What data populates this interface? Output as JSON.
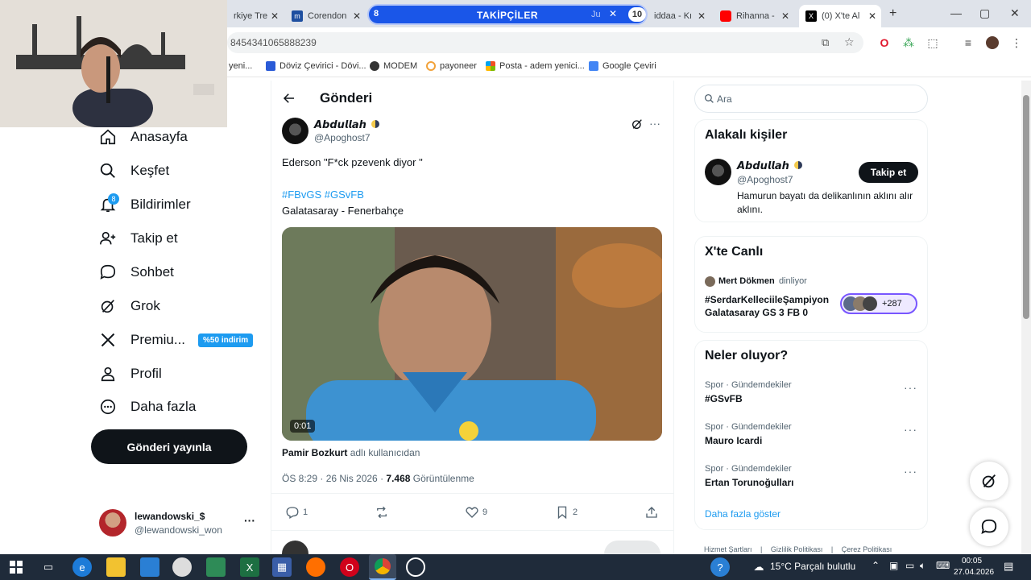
{
  "browser": {
    "tabs": [
      {
        "label": "rkiye Tre",
        "favicon": "generic-icon"
      },
      {
        "label": "Corendon",
        "favicon": "corendon-icon",
        "color": "#1e4fa0"
      },
      {
        "label": "Ju",
        "favicon": "generic-icon"
      },
      {
        "label": "iddaa - Kı",
        "favicon": "iddaa-icon"
      },
      {
        "label": "Rihanna -",
        "favicon": "youtube-icon",
        "color": "#ff0000"
      },
      {
        "label": "(0) X'te Al",
        "favicon": "x-icon",
        "active": true
      }
    ],
    "tab_group": {
      "title": "TAKİPÇİLER",
      "left_count": "8",
      "right_count": "10",
      "color": "#1a56e8"
    },
    "new_tab": "+",
    "window_controls": [
      "—",
      "▢",
      "✕"
    ],
    "url": "8454341065888239",
    "bookmarks": [
      {
        "label": "yeni...",
        "icon": "doc-icon"
      },
      {
        "label": "Döviz Çevirici - Dövi...",
        "icon": "exchange-icon"
      },
      {
        "label": "MODEM",
        "icon": "globe-icon"
      },
      {
        "label": "payoneer",
        "icon": "payoneer-icon"
      },
      {
        "label": "Posta - adem yenici...",
        "icon": "microsoft-icon"
      },
      {
        "label": "Google Çeviri",
        "icon": "translate-icon"
      }
    ]
  },
  "left_nav": {
    "items": [
      {
        "label": "Anasayfa",
        "icon": "home-icon"
      },
      {
        "label": "Keşfet",
        "icon": "search-icon"
      },
      {
        "label": "Bildirimler",
        "icon": "bell-icon",
        "badge": "8"
      },
      {
        "label": "Takip et",
        "icon": "person-add-icon"
      },
      {
        "label": "Sohbet",
        "icon": "chat-icon"
      },
      {
        "label": "Grok",
        "icon": "grok-icon"
      },
      {
        "label": "Premiu...",
        "icon": "x-logo-icon",
        "promo": "%50 indirim"
      },
      {
        "label": "Profil",
        "icon": "person-icon"
      },
      {
        "label": "Daha fazla",
        "icon": "more-circle-icon"
      }
    ],
    "post_button": "Gönderi yayınla",
    "account": {
      "name": "lewandowski_$",
      "handle": "@lewandowski_won",
      "more": "···"
    }
  },
  "post": {
    "header_title": "Gönderi",
    "author_name": "𝘼𝙗𝙙𝙪𝙡𝙡𝙖𝙝",
    "author_handle": "@Apoghost7",
    "text": "Ederson \"F*ck pzevenk diyor \"",
    "hashtags": "#FBvGS #GSvFB",
    "line2": "Galatasaray - Fenerbahçe",
    "video_time": "0:01",
    "attribution_user": "Pamir Bozkurt",
    "attribution_suffix": "adlı kullanıcıdan",
    "time": "ÖS 8:29 · 26 Nis 2026 · ",
    "views": "7.468",
    "views_label": "Görüntülenme",
    "replies": "1",
    "likes": "9",
    "bookmarks": "2"
  },
  "right": {
    "search_placeholder": "Ara",
    "related_title": "Alakalı kişiler",
    "related": {
      "name": "𝘼𝙗𝙙𝙪𝙡𝙡𝙖𝙝",
      "handle": "@Apoghost7",
      "bio": "Hamurun bayatı da delikanlının aklını alır aklını.",
      "follow": "Takip et"
    },
    "live_title": "X'te Canlı",
    "live": {
      "host": "Mert Dökmen",
      "status": "dinliyor",
      "title": "#SerdarKelleciileŞampiyonGalatasaray GS 3 FB 0",
      "count": "+287"
    },
    "trends_title": "Neler oluyor?",
    "trends": [
      {
        "context": "Spor · Gündemdekiler",
        "name": "#GSvFB"
      },
      {
        "context": "Spor · Gündemdekiler",
        "name": "Mauro Icardi"
      },
      {
        "context": "Spor · Gündemdekiler",
        "name": "Ertan Torunoğulları"
      }
    ],
    "show_more": "Daha fazla göster",
    "footer": [
      "Hizmet Şartları",
      "Gizlilik Politikası",
      "Çerez Politikası"
    ]
  },
  "taskbar": {
    "weather": "15°C  Parçalı bulutlu",
    "time": "00:05",
    "date": "27.04.2026"
  },
  "colors": {
    "accent": "#1d9bf0",
    "dark": "#0f1419",
    "muted": "#536471"
  }
}
